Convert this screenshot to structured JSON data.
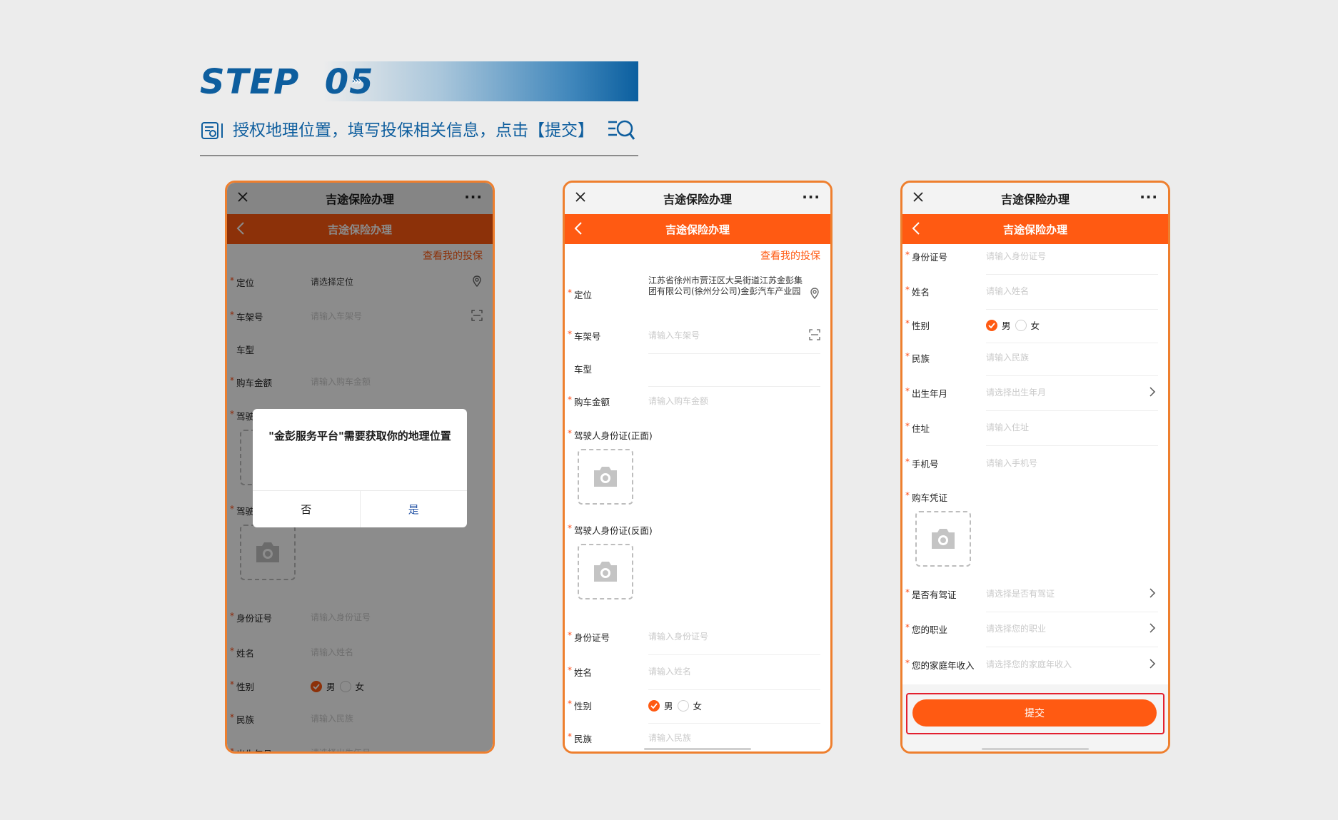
{
  "header": {
    "step_label": "STEP",
    "step_number": "05",
    "arrows": "›››",
    "subtitle": "授权地理位置，填写投保相关信息，点击【提交】"
  },
  "app": {
    "window_title": "吉途保险办理",
    "nav_title": "吉途保险办理",
    "more": "···",
    "view_policy": "查看我的投保"
  },
  "phone1": {
    "rows": [
      {
        "label": "定位",
        "value": "请选择定位",
        "required": "*"
      },
      {
        "label": "车架号",
        "value": "请输入车架号",
        "required": "*"
      },
      {
        "label": "车型",
        "value": ""
      },
      {
        "label": "购车金额",
        "value": "请输入购车金额",
        "required": "*"
      },
      {
        "label": "驾驶",
        "required": "*"
      },
      {
        "label": "驾驶",
        "required": "*"
      },
      {
        "label": "身份证号",
        "value": "请输入身份证号",
        "required": "*"
      },
      {
        "label": "姓名",
        "value": "请输入姓名",
        "required": "*"
      },
      {
        "label": "性别",
        "required": "*"
      },
      {
        "label": "民族",
        "value": "请输入民族",
        "required": "*"
      },
      {
        "label": "出生年月",
        "value": "请选择出生年月",
        "required": "*"
      }
    ],
    "gender_male": "男",
    "gender_female": "女",
    "dialog": {
      "message": "\"金彭服务平台\"需要获取你的地理位置",
      "no": "否",
      "yes": "是"
    }
  },
  "phone2": {
    "location_label": "定位",
    "location_value": "江苏省徐州市贾汪区大吴街道江苏金彭集团有限公司(徐州分公司)金彭汽车产业园",
    "vin_label": "车架号",
    "vin_placeholder": "请输入车架号",
    "model_label": "车型",
    "price_label": "购车金额",
    "price_placeholder": "请输入购车金额",
    "id_front_label": "驾驶人身份证(正面)",
    "id_back_label": "驾驶人身份证(反面)",
    "id_label": "身份证号",
    "id_placeholder": "请输入身份证号",
    "name_label": "姓名",
    "name_placeholder": "请输入姓名",
    "gender_label": "性别",
    "gender_male": "男",
    "gender_female": "女",
    "ethnic_label": "民族",
    "ethnic_placeholder": "请输入民族"
  },
  "phone3": {
    "id_label": "身份证号",
    "id_placeholder": "请输入身份证号",
    "name_label": "姓名",
    "name_placeholder": "请输入姓名",
    "gender_label": "性别",
    "gender_male": "男",
    "gender_female": "女",
    "ethnic_label": "民族",
    "ethnic_placeholder": "请输入民族",
    "birth_label": "出生年月",
    "birth_placeholder": "请选择出生年月",
    "address_label": "住址",
    "address_placeholder": "请输入住址",
    "phone_label": "手机号",
    "phone_placeholder": "请输入手机号",
    "receipt_label": "购车凭证",
    "license_label": "是否有驾证",
    "license_placeholder": "请选择是否有驾证",
    "job_label": "您的职业",
    "job_placeholder": "请选择您的职业",
    "income_label": "您的家庭年收入",
    "income_placeholder": "请选择您的家庭年收入",
    "submit": "提交"
  },
  "colors": {
    "brand_orange": "#ff5a12",
    "frame_orange": "#ee7f2e",
    "heading_blue": "#0e5e9e",
    "highlight_red": "#e3202f"
  }
}
